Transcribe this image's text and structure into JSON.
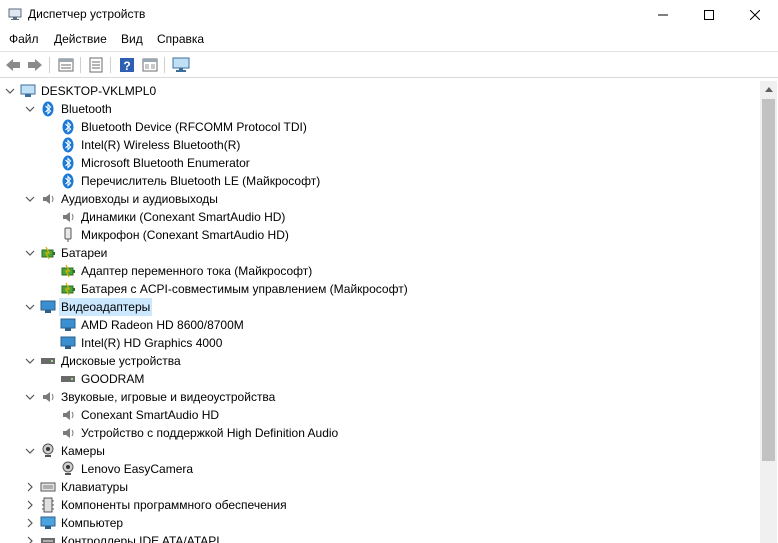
{
  "window": {
    "title": "Диспетчер устройств",
    "controls": {
      "minimize": "—",
      "maximize": "☐",
      "close": "✕"
    }
  },
  "menu": [
    "Файл",
    "Действие",
    "Вид",
    "Справка"
  ],
  "toolbar": [
    "back-icon",
    "forward-icon",
    "properties-icon",
    "update-driver-icon",
    "help-icon",
    "view-icon",
    "monitor-icon"
  ],
  "tree": {
    "root": "DESKTOP-VKLMPL0",
    "nodes": [
      {
        "label": "Bluetooth",
        "expanded": true,
        "icon": "bluetooth-icon",
        "children": [
          "Bluetooth Device (RFCOMM Protocol TDI)",
          "Intel(R) Wireless Bluetooth(R)",
          "Microsoft Bluetooth Enumerator",
          "Перечислитель Bluetooth LE (Майкрософт)"
        ]
      },
      {
        "label": "Аудиовходы и аудиовыходы",
        "expanded": true,
        "icon": "speaker-icon",
        "children": [
          "Динамики (Conexant SmartAudio HD)",
          "Микрофон (Conexant SmartAudio HD)"
        ]
      },
      {
        "label": "Батареи",
        "expanded": true,
        "icon": "battery-icon",
        "children": [
          "Адаптер переменного тока (Майкрософт)",
          "Батарея с ACPI-совместимым управлением (Майкрософт)"
        ]
      },
      {
        "label": "Видеоадаптеры",
        "expanded": true,
        "icon": "display-adapter-icon",
        "selected": true,
        "children": [
          "AMD Radeon HD 8600/8700M",
          "Intel(R) HD Graphics 4000"
        ]
      },
      {
        "label": "Дисковые устройства",
        "expanded": true,
        "icon": "disk-drive-icon",
        "children": [
          "GOODRAM"
        ]
      },
      {
        "label": "Звуковые, игровые и видеоустройства",
        "expanded": true,
        "icon": "sound-icon",
        "children": [
          "Conexant SmartAudio HD",
          "Устройство с поддержкой High Definition Audio"
        ]
      },
      {
        "label": "Камеры",
        "expanded": true,
        "icon": "camera-icon",
        "children": [
          "Lenovo EasyCamera"
        ]
      },
      {
        "label": "Клавиатуры",
        "expanded": false,
        "icon": "keyboard-icon",
        "children": []
      },
      {
        "label": "Компоненты программного обеспечения",
        "expanded": false,
        "icon": "software-component-icon",
        "children": []
      },
      {
        "label": "Компьютер",
        "expanded": false,
        "icon": "computer-icon",
        "children": []
      },
      {
        "label": "Контроллеры IDE ATA/ATAPI",
        "expanded": false,
        "icon": "ide-controller-icon",
        "children": []
      }
    ]
  },
  "colors": {
    "selection": "#cce8ff",
    "bluetooth": "#1a78d6",
    "scroll_thumb": "#c2c2c2"
  }
}
